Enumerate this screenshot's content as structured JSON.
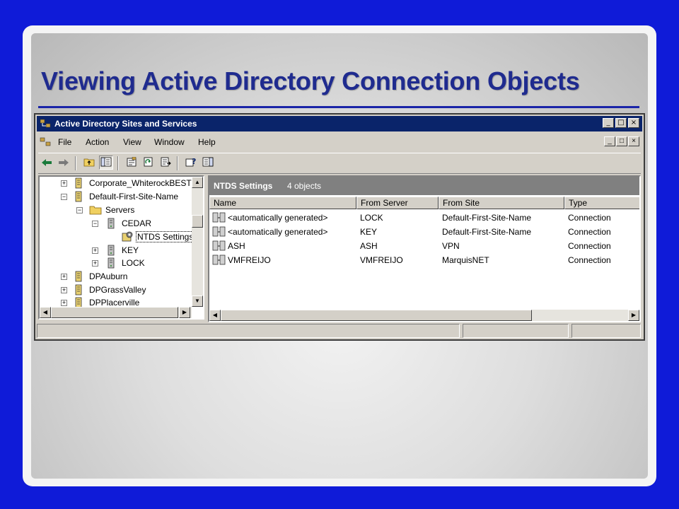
{
  "slide": {
    "title": "Viewing Active Directory Connection Objects"
  },
  "window": {
    "title": "Active Directory Sites and Services"
  },
  "menu": [
    "File",
    "Action",
    "View",
    "Window",
    "Help"
  ],
  "tree": {
    "items": [
      {
        "label": "Corporate_WhiterockBEST"
      },
      {
        "label": "Default-First-Site-Name"
      },
      {
        "label": "Servers"
      },
      {
        "label": "CEDAR"
      },
      {
        "label": "NTDS Settings"
      },
      {
        "label": "KEY"
      },
      {
        "label": "LOCK"
      },
      {
        "label": "DPAuburn"
      },
      {
        "label": "DPGrassValley"
      },
      {
        "label": "DPPlacerville"
      }
    ]
  },
  "details": {
    "header_title": "NTDS Settings",
    "header_count": "4 objects",
    "columns": [
      "Name",
      "From Server",
      "From Site",
      "Type"
    ],
    "rows": [
      [
        "<automatically generated>",
        "LOCK",
        "Default-First-Site-Name",
        "Connection"
      ],
      [
        "<automatically generated>",
        "KEY",
        "Default-First-Site-Name",
        "Connection"
      ],
      [
        "ASH",
        "ASH",
        "VPN",
        "Connection"
      ],
      [
        "VMFREIJO",
        "VMFREIJO",
        "MarquisNET",
        "Connection"
      ]
    ]
  },
  "window_buttons": {
    "minimize": "_",
    "maximize": "□",
    "close": "×"
  },
  "colors": {
    "title_text": "#1f2b8f",
    "titlebar": "#0a246a",
    "page_bg": "#0f1bd8",
    "pane_header": "#808080"
  }
}
